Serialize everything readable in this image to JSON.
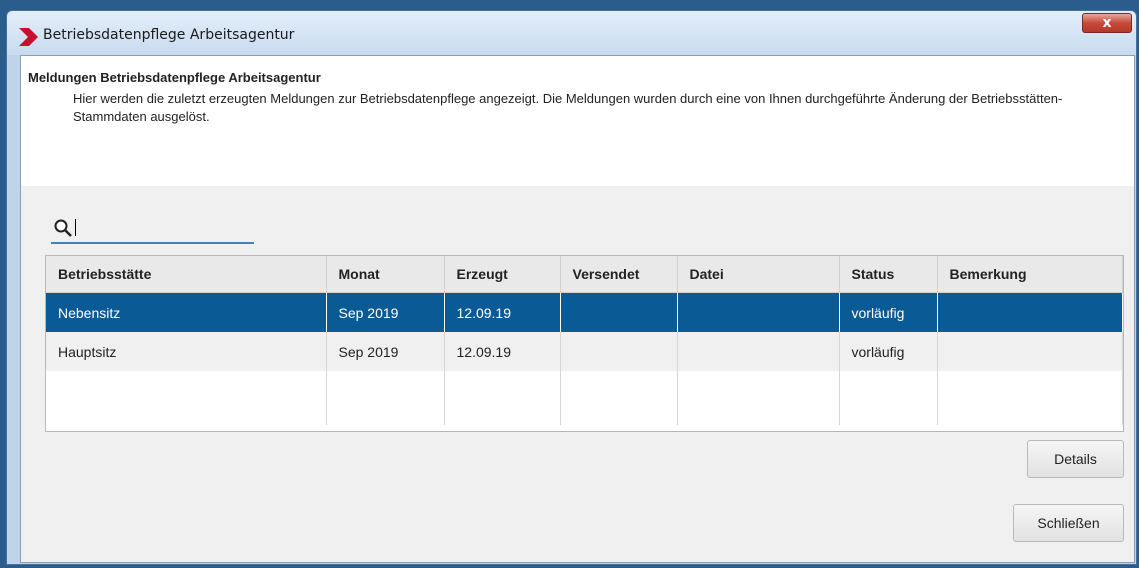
{
  "window": {
    "title": "Betriebsdatenpflege Arbeitsagentur",
    "close_label": "x"
  },
  "header": {
    "title": "Meldungen Betriebsdatenpflege Arbeitsagentur",
    "description": "Hier werden die zuletzt erzeugten Meldungen zur Betriebsdatenpflege angezeigt. Die Meldungen wurden durch eine von Ihnen durchgeführte Änderung der Betriebsstätten-Stammdaten ausgelöst."
  },
  "search": {
    "value": "",
    "icon": "search-icon"
  },
  "table": {
    "columns": [
      "Betriebsstätte",
      "Monat",
      "Erzeugt",
      "Versendet",
      "Datei",
      "Status",
      "Bemerkung"
    ],
    "rows": [
      {
        "betriebsstaette": "Nebensitz",
        "monat": "Sep 2019",
        "erzeugt": "12.09.19",
        "versendet": "",
        "datei": "",
        "status": "vorläufig",
        "bemerkung": ""
      },
      {
        "betriebsstaette": "Hauptsitz",
        "monat": "Sep 2019",
        "erzeugt": "12.09.19",
        "versendet": "",
        "datei": "",
        "status": "vorläufig",
        "bemerkung": ""
      }
    ],
    "selected_row": 0
  },
  "buttons": {
    "details": "Details",
    "close": "Schließen"
  },
  "colors": {
    "selection": "#0a5a96",
    "accent": "#c8102e"
  }
}
